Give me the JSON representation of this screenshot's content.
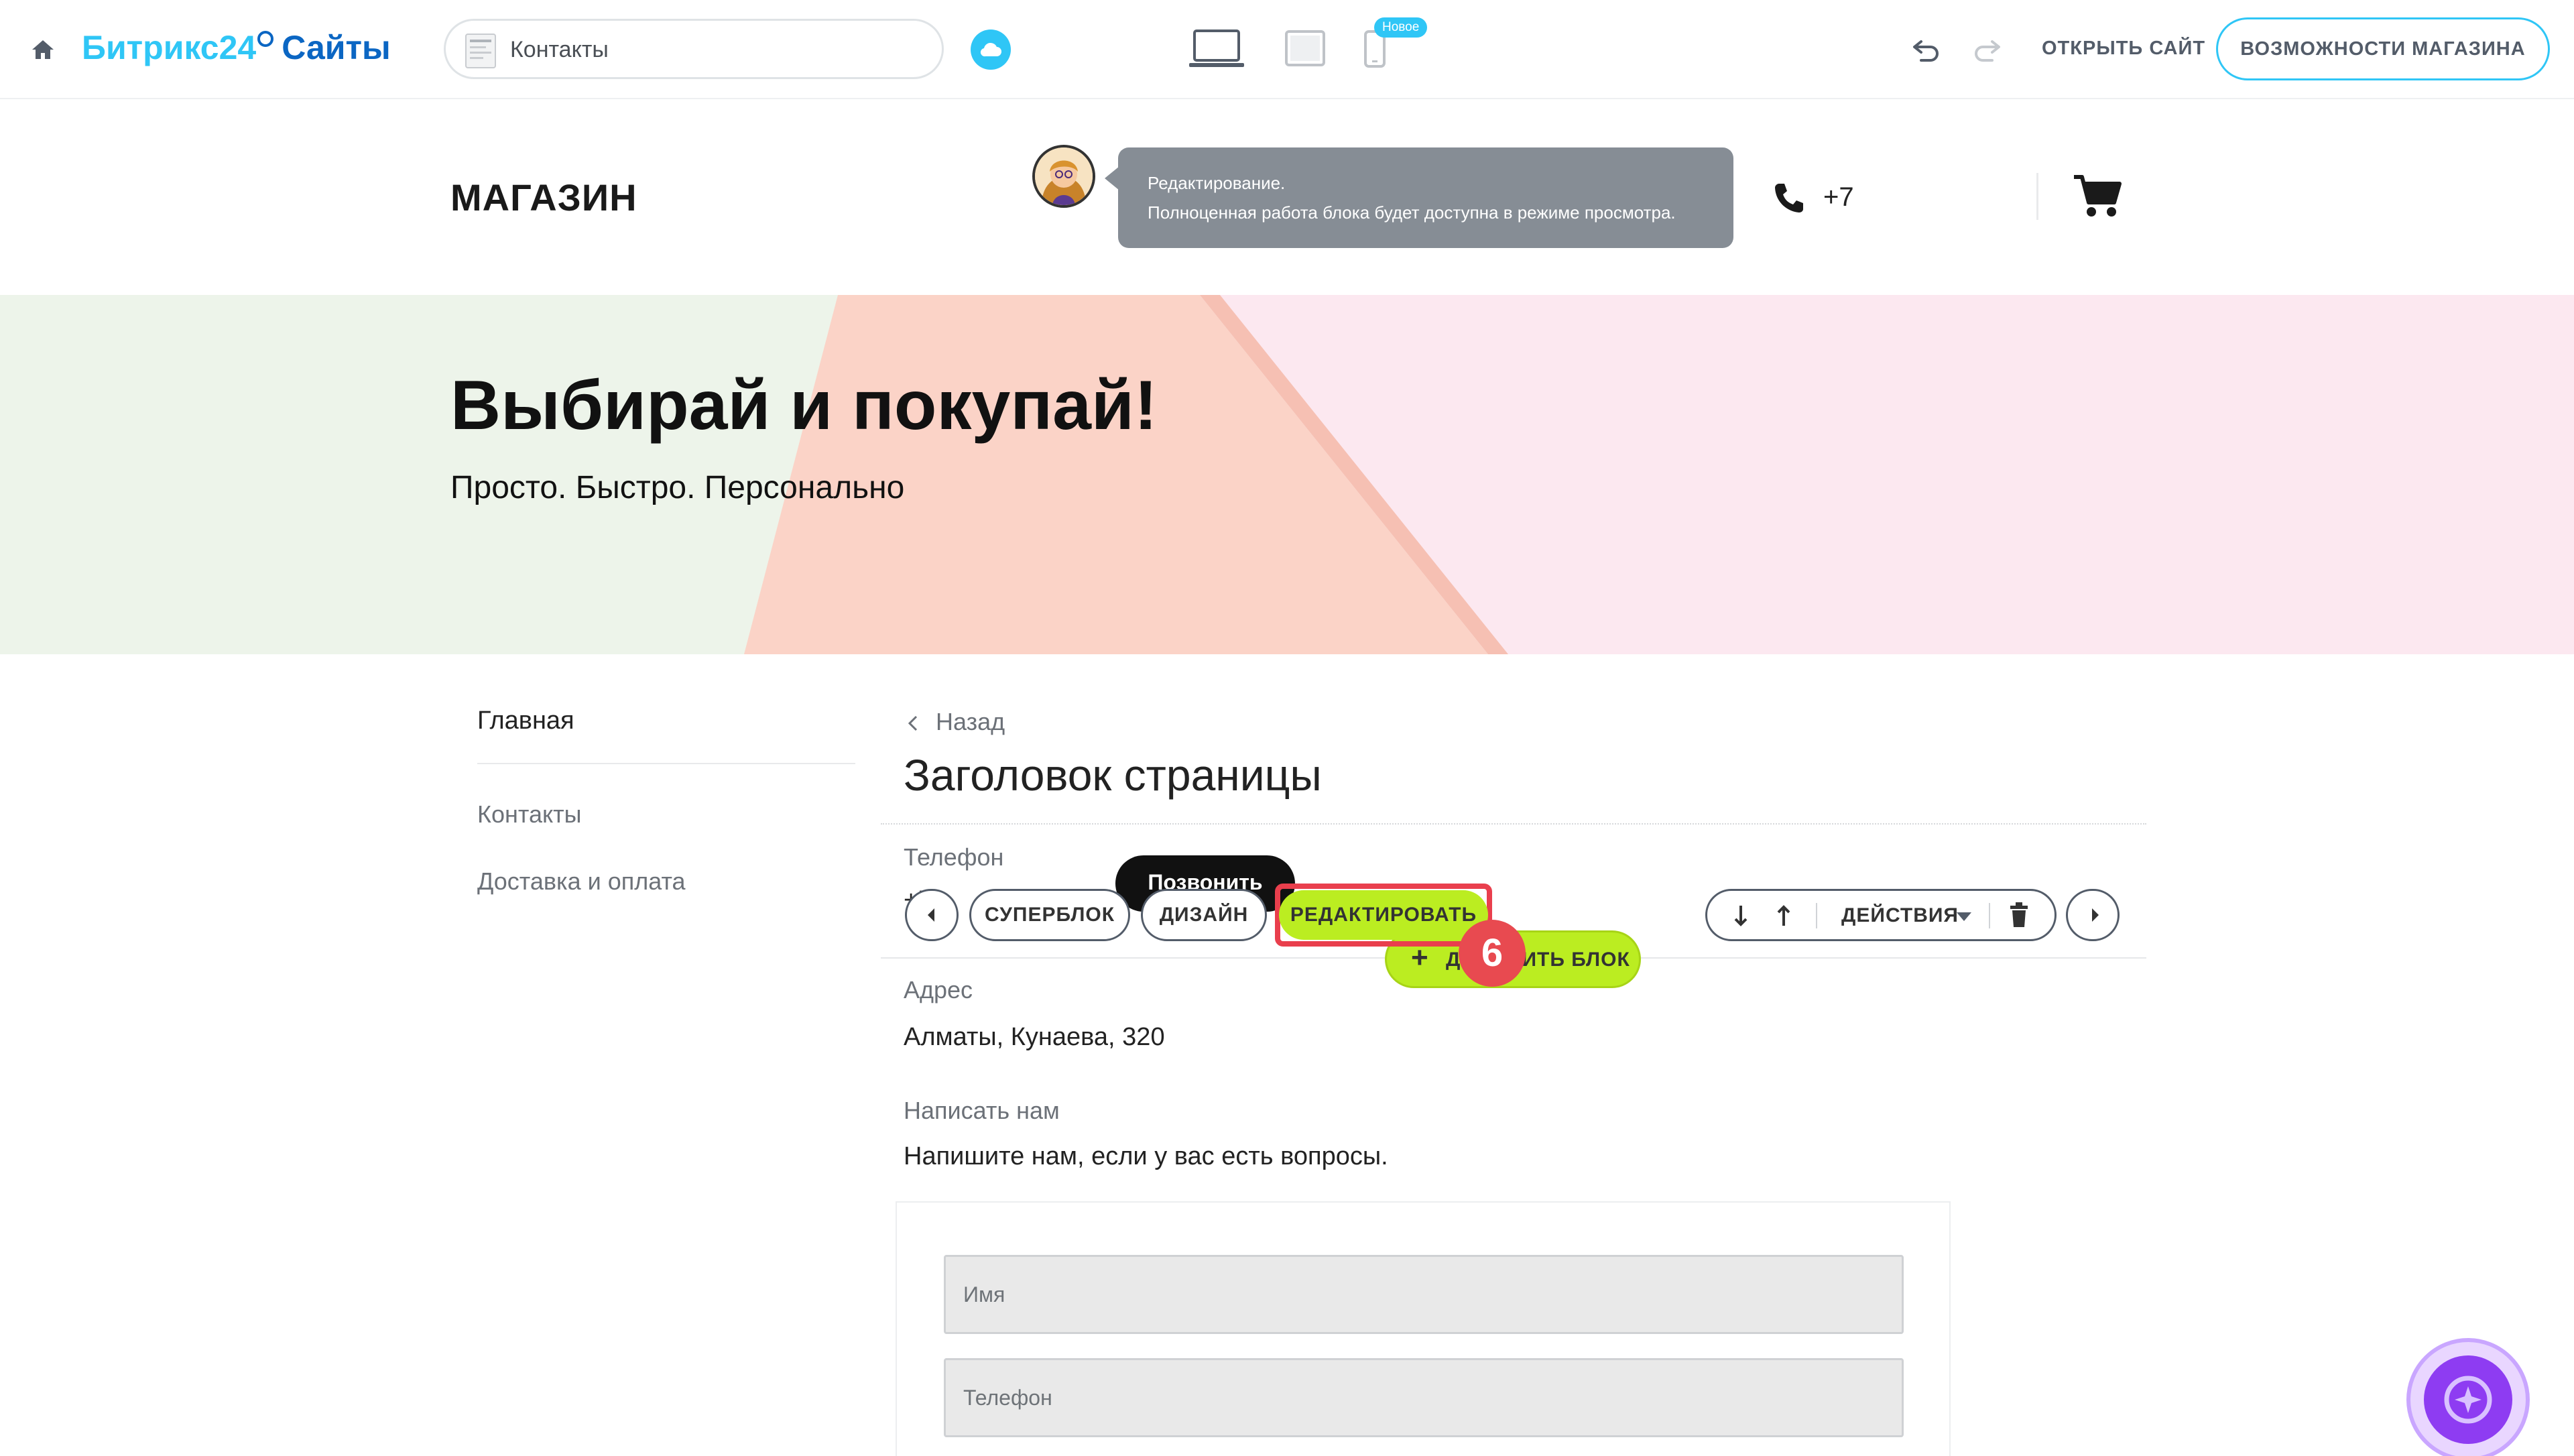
{
  "editor_bar": {
    "brand_part1": "Битрикс24",
    "brand_part2": "Сайты",
    "page_selector": "Контакты",
    "new_badge": "Новое",
    "open_site": "ОТКРЫТЬ САЙТ",
    "shop_features": "ВОЗМОЖНОСТИ МАГАЗИНА",
    "icons": [
      "home-icon",
      "cloud-icon",
      "laptop-icon",
      "tablet-icon",
      "phone-device-icon",
      "undo-icon",
      "redo-icon"
    ]
  },
  "site_header": {
    "logo": "МАГАЗИН",
    "tooltip_line1": "Редактирование.",
    "tooltip_line2": "Полноценная работа блока будет доступна в режиме просмотра.",
    "phone": "+7"
  },
  "hero": {
    "title": "Выбирай и покупай!",
    "subtitle": "Просто. Быстро. Персонально"
  },
  "side_menu": {
    "items": [
      "Главная",
      "Контакты",
      "Доставка и оплата"
    ]
  },
  "content": {
    "back": "Назад",
    "page_title": "Заголовок страницы",
    "phone_label": "Телефон",
    "phone_value": "+79",
    "call_button": "Позвонить",
    "address_label": "Адрес",
    "address_value": "Алматы, Кунаева, 320",
    "write_label": "Написать нам",
    "write_value": "Напишите нам, если у вас есть вопросы."
  },
  "block_toolbar": {
    "superblock": "СУПЕРБЛОК",
    "design": "ДИЗАЙН",
    "edit": "РЕДАКТИРОВАТЬ",
    "actions": "ДЕЙСТВИЯ",
    "add_block": "ДОБАВИТЬ БЛОК",
    "step_number": "6"
  },
  "form": {
    "name_placeholder": "Имя",
    "phone_placeholder": "Телефон"
  },
  "colors": {
    "accent_blue": "#2fc6f6",
    "brand_dark_blue": "#0b66c3",
    "edit_green": "#bbed21",
    "highlight_red": "#e93f4d",
    "tooltip_gray": "#868d95",
    "assistant_purple": "#8e3cf2"
  }
}
